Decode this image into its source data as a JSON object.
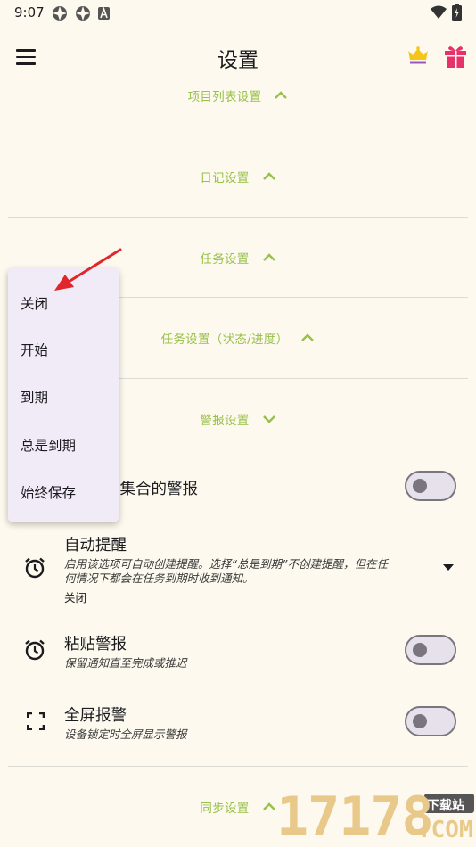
{
  "status": {
    "time": "9:07"
  },
  "header": {
    "title": "设置"
  },
  "sections": {
    "project_list": "项目列表设置",
    "diary": "日记设置",
    "task": "任务设置",
    "task_status": "任务设置（状态/进度）",
    "alarm": "警报设置",
    "sync": "同步设置"
  },
  "rows": {
    "continuous": {
      "title_partial": "续集合的警报"
    },
    "auto_remind": {
      "title": "自动提醒",
      "desc_line1": "启用该选项可自动创建提醒。选择“总是到期”不创建提醒，但在任",
      "desc_line2": "何情况下都会在任务到期时收到通知。",
      "value": "关闭"
    },
    "sticky": {
      "title": "粘贴警报",
      "desc": "保留通知直至完成或推迟"
    },
    "fullscreen": {
      "title": "全屏报警",
      "desc": "设备锁定时全屏显示警报"
    }
  },
  "dropdown": {
    "options": [
      "关闭",
      "开始",
      "到期",
      "总是到期",
      "始终保存"
    ]
  },
  "watermark": {
    "site": "下载站",
    "number": "17178",
    "domain": ".COM"
  },
  "colors": {
    "accent": "#98c14a",
    "background": "#fdf9ee",
    "popup": "#f1ebf7",
    "annotation_arrow": "#e0262b"
  }
}
